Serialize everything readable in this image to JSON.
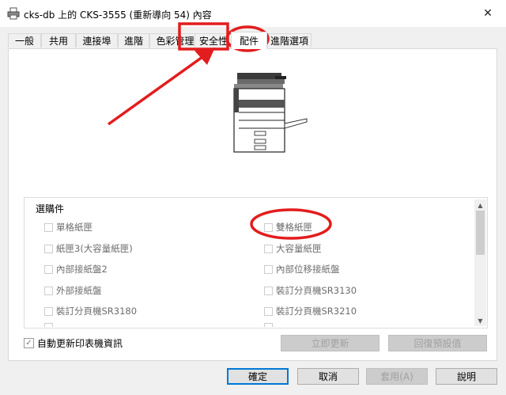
{
  "window": {
    "title": "cks-db 上的 CKS-3555 (重新導向 54) 內容",
    "close_glyph": "✕"
  },
  "tabs": [
    {
      "label": "一般"
    },
    {
      "label": "共用"
    },
    {
      "label": "連接埠"
    },
    {
      "label": "進階"
    },
    {
      "label": "色彩管理"
    },
    {
      "label": "安全性"
    },
    {
      "label": "配件"
    },
    {
      "label": "進階選項"
    }
  ],
  "active_tab": "配件",
  "options_group": {
    "title": "選購件",
    "left_column": [
      {
        "label": "單格紙匣",
        "checked": false
      },
      {
        "label": "紙匣3(大容量紙匣)",
        "checked": false
      },
      {
        "label": "內部接紙盤2",
        "checked": false
      },
      {
        "label": "外部接紙盤",
        "checked": false
      },
      {
        "label": "裝訂分頁機SR3180",
        "checked": false
      }
    ],
    "right_column": [
      {
        "label": "雙格紙匣",
        "checked": false
      },
      {
        "label": "大容量紙匣",
        "checked": false
      },
      {
        "label": "內部位移接紙盤",
        "checked": false
      },
      {
        "label": "裝訂分頁機SR3130",
        "checked": false
      },
      {
        "label": "裝訂分頁機SR3210",
        "checked": false
      }
    ]
  },
  "auto_update": {
    "label": "自動更新印表機資訊",
    "checked": true
  },
  "action_buttons": {
    "update_now": "立即更新",
    "restore_defaults": "回復預設值"
  },
  "dialog_buttons": {
    "ok": "確定",
    "cancel": "取消",
    "apply": "套用(A)",
    "help": "說明"
  },
  "colors": {
    "annotation_red": "#e31d1d",
    "focus_blue": "#0078d7"
  },
  "icons": {
    "title": "printer-icon",
    "close": "close-icon",
    "scroll_up": "chevron-up-icon",
    "scroll_down": "chevron-down-icon"
  }
}
